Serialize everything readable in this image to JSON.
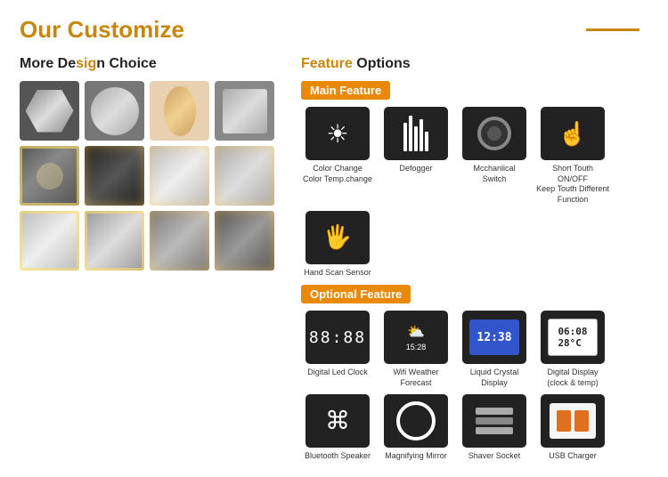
{
  "header": {
    "title_our": "Our ",
    "title_customize": "Customize",
    "line": true
  },
  "left": {
    "section_title_part1": "More De",
    "section_title_highlight": "sig",
    "section_title_part2": "n Choice",
    "row1": [
      {
        "type": "hex",
        "label": "Hexagon"
      },
      {
        "type": "circle",
        "label": "Circle"
      },
      {
        "type": "oval",
        "label": "Oval"
      },
      {
        "type": "rect",
        "label": "Rectangle"
      }
    ],
    "row2": [
      {
        "style": "mr2-a",
        "glow": true
      },
      {
        "style": "mr2-b",
        "glow": true
      },
      {
        "style": "mr2-c",
        "glow": false
      },
      {
        "style": "mr2-d",
        "glow": false
      }
    ],
    "row3": [
      {
        "style": "mr3-a"
      },
      {
        "style": "mr3-b"
      },
      {
        "style": "mr3-c"
      },
      {
        "style": "mr3-d"
      }
    ]
  },
  "right": {
    "section_title_part1": "",
    "section_title_highlight": "Feature",
    "section_title_part2": " Options",
    "main_feature_label": "Main Feature",
    "main_features": [
      {
        "id": "color-change",
        "icon_type": "sun",
        "label": "Color Change\nColor Temp.change"
      },
      {
        "id": "defogger",
        "icon_type": "defog",
        "label": "Defogger"
      },
      {
        "id": "mechanical-switch",
        "icon_type": "switch",
        "label": "Mcchanlical\nSwitch"
      },
      {
        "id": "short-touch",
        "icon_type": "touch",
        "label": "Short Touth ON/OFF\nKeep Touth Different\nFunction"
      },
      {
        "id": "hand-scan",
        "icon_type": "hand",
        "label": "Hand Scan Sensor"
      }
    ],
    "optional_feature_label": "Optional Feature",
    "optional_features": [
      {
        "id": "digital-led-clock",
        "icon_type": "clock-led",
        "label": "Digital Led Clock",
        "icon_text": "88:88"
      },
      {
        "id": "wifi-weather",
        "icon_type": "weather",
        "label": "Wifi Weather Forecast",
        "icon_text": "☁ 15:28"
      },
      {
        "id": "lcd",
        "icon_type": "lcd",
        "label": "Liquid Crystal Display",
        "icon_text": "12:38"
      },
      {
        "id": "digital-display",
        "icon_type": "digital-disp",
        "label": "Digital Display\n(clock & temp)",
        "icon_text": "06:08\n28°C"
      }
    ],
    "optional_features2": [
      {
        "id": "bluetooth-speaker",
        "icon_type": "bt",
        "label": "Bluetooth Speaker"
      },
      {
        "id": "magnifying-mirror",
        "icon_type": "magnify",
        "label": "Magnifying Mirror"
      },
      {
        "id": "shaver-socket",
        "icon_type": "shaver",
        "label": "Shaver Socket"
      },
      {
        "id": "usb-charger",
        "icon_type": "usb",
        "label": "USB Charger"
      }
    ]
  }
}
